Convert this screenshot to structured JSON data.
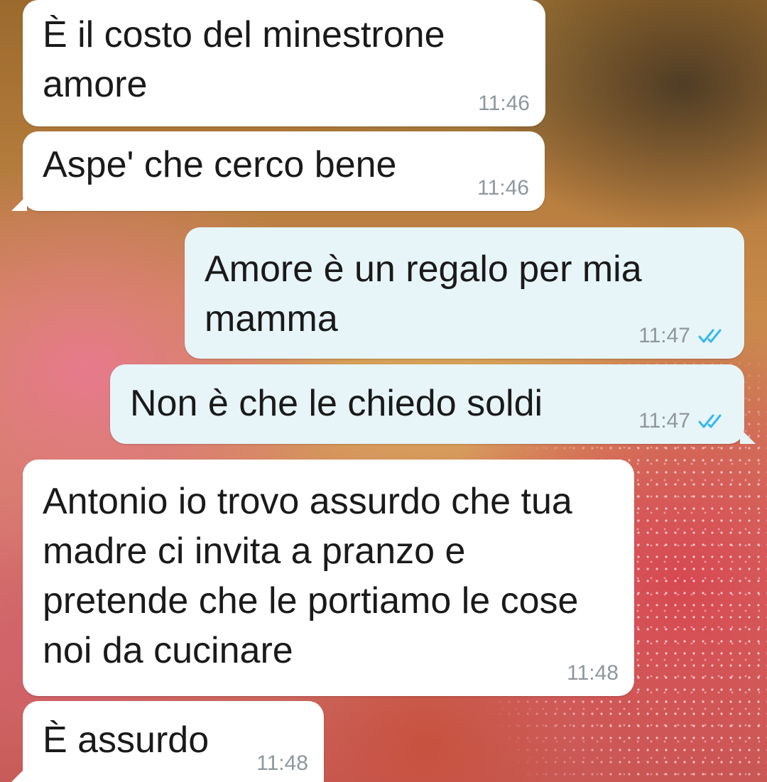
{
  "colors": {
    "incoming_bubble": "#ffffff",
    "outgoing_bubble": "#e7f4f8",
    "timestamp": "#8e979c",
    "read_ticks": "#34b7f1"
  },
  "messages": [
    {
      "direction": "incoming",
      "text": "È il costo del minestrone amore",
      "time": "11:46"
    },
    {
      "direction": "incoming",
      "text": "Aspe' che cerco bene",
      "time": "11:46"
    },
    {
      "direction": "outgoing",
      "text": "Amore è un regalo per mia mamma",
      "time": "11:47",
      "status": "read"
    },
    {
      "direction": "outgoing",
      "text": "Non è che le chiedo soldi",
      "time": "11:47",
      "status": "read"
    },
    {
      "direction": "incoming",
      "text": "Antonio io trovo assurdo che tua madre ci invita a pranzo e pretende che le portiamo le cose noi da cucinare",
      "time": "11:48"
    },
    {
      "direction": "incoming",
      "text": "È assurdo",
      "time": "11:48"
    }
  ]
}
